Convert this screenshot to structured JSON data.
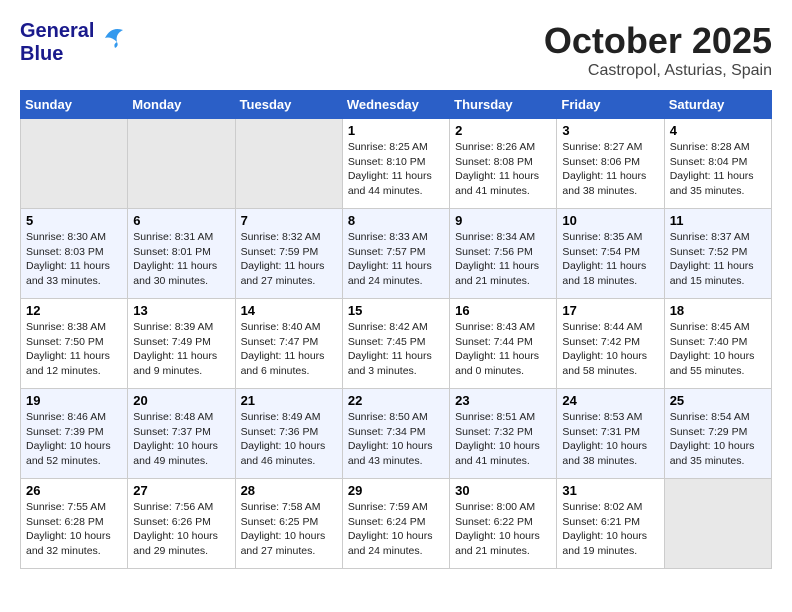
{
  "header": {
    "logo_line1": "General",
    "logo_line2": "Blue",
    "title": "October 2025",
    "subtitle": "Castropol, Asturias, Spain"
  },
  "days_of_week": [
    "Sunday",
    "Monday",
    "Tuesday",
    "Wednesday",
    "Thursday",
    "Friday",
    "Saturday"
  ],
  "weeks": [
    [
      {
        "day": "",
        "sunrise": "",
        "sunset": "",
        "daylight": "",
        "empty": true
      },
      {
        "day": "",
        "sunrise": "",
        "sunset": "",
        "daylight": "",
        "empty": true
      },
      {
        "day": "",
        "sunrise": "",
        "sunset": "",
        "daylight": "",
        "empty": true
      },
      {
        "day": "1",
        "sunrise": "Sunrise: 8:25 AM",
        "sunset": "Sunset: 8:10 PM",
        "daylight": "Daylight: 11 hours and 44 minutes.",
        "empty": false
      },
      {
        "day": "2",
        "sunrise": "Sunrise: 8:26 AM",
        "sunset": "Sunset: 8:08 PM",
        "daylight": "Daylight: 11 hours and 41 minutes.",
        "empty": false
      },
      {
        "day": "3",
        "sunrise": "Sunrise: 8:27 AM",
        "sunset": "Sunset: 8:06 PM",
        "daylight": "Daylight: 11 hours and 38 minutes.",
        "empty": false
      },
      {
        "day": "4",
        "sunrise": "Sunrise: 8:28 AM",
        "sunset": "Sunset: 8:04 PM",
        "daylight": "Daylight: 11 hours and 35 minutes.",
        "empty": false
      }
    ],
    [
      {
        "day": "5",
        "sunrise": "Sunrise: 8:30 AM",
        "sunset": "Sunset: 8:03 PM",
        "daylight": "Daylight: 11 hours and 33 minutes.",
        "empty": false
      },
      {
        "day": "6",
        "sunrise": "Sunrise: 8:31 AM",
        "sunset": "Sunset: 8:01 PM",
        "daylight": "Daylight: 11 hours and 30 minutes.",
        "empty": false
      },
      {
        "day": "7",
        "sunrise": "Sunrise: 8:32 AM",
        "sunset": "Sunset: 7:59 PM",
        "daylight": "Daylight: 11 hours and 27 minutes.",
        "empty": false
      },
      {
        "day": "8",
        "sunrise": "Sunrise: 8:33 AM",
        "sunset": "Sunset: 7:57 PM",
        "daylight": "Daylight: 11 hours and 24 minutes.",
        "empty": false
      },
      {
        "day": "9",
        "sunrise": "Sunrise: 8:34 AM",
        "sunset": "Sunset: 7:56 PM",
        "daylight": "Daylight: 11 hours and 21 minutes.",
        "empty": false
      },
      {
        "day": "10",
        "sunrise": "Sunrise: 8:35 AM",
        "sunset": "Sunset: 7:54 PM",
        "daylight": "Daylight: 11 hours and 18 minutes.",
        "empty": false
      },
      {
        "day": "11",
        "sunrise": "Sunrise: 8:37 AM",
        "sunset": "Sunset: 7:52 PM",
        "daylight": "Daylight: 11 hours and 15 minutes.",
        "empty": false
      }
    ],
    [
      {
        "day": "12",
        "sunrise": "Sunrise: 8:38 AM",
        "sunset": "Sunset: 7:50 PM",
        "daylight": "Daylight: 11 hours and 12 minutes.",
        "empty": false
      },
      {
        "day": "13",
        "sunrise": "Sunrise: 8:39 AM",
        "sunset": "Sunset: 7:49 PM",
        "daylight": "Daylight: 11 hours and 9 minutes.",
        "empty": false
      },
      {
        "day": "14",
        "sunrise": "Sunrise: 8:40 AM",
        "sunset": "Sunset: 7:47 PM",
        "daylight": "Daylight: 11 hours and 6 minutes.",
        "empty": false
      },
      {
        "day": "15",
        "sunrise": "Sunrise: 8:42 AM",
        "sunset": "Sunset: 7:45 PM",
        "daylight": "Daylight: 11 hours and 3 minutes.",
        "empty": false
      },
      {
        "day": "16",
        "sunrise": "Sunrise: 8:43 AM",
        "sunset": "Sunset: 7:44 PM",
        "daylight": "Daylight: 11 hours and 0 minutes.",
        "empty": false
      },
      {
        "day": "17",
        "sunrise": "Sunrise: 8:44 AM",
        "sunset": "Sunset: 7:42 PM",
        "daylight": "Daylight: 10 hours and 58 minutes.",
        "empty": false
      },
      {
        "day": "18",
        "sunrise": "Sunrise: 8:45 AM",
        "sunset": "Sunset: 7:40 PM",
        "daylight": "Daylight: 10 hours and 55 minutes.",
        "empty": false
      }
    ],
    [
      {
        "day": "19",
        "sunrise": "Sunrise: 8:46 AM",
        "sunset": "Sunset: 7:39 PM",
        "daylight": "Daylight: 10 hours and 52 minutes.",
        "empty": false
      },
      {
        "day": "20",
        "sunrise": "Sunrise: 8:48 AM",
        "sunset": "Sunset: 7:37 PM",
        "daylight": "Daylight: 10 hours and 49 minutes.",
        "empty": false
      },
      {
        "day": "21",
        "sunrise": "Sunrise: 8:49 AM",
        "sunset": "Sunset: 7:36 PM",
        "daylight": "Daylight: 10 hours and 46 minutes.",
        "empty": false
      },
      {
        "day": "22",
        "sunrise": "Sunrise: 8:50 AM",
        "sunset": "Sunset: 7:34 PM",
        "daylight": "Daylight: 10 hours and 43 minutes.",
        "empty": false
      },
      {
        "day": "23",
        "sunrise": "Sunrise: 8:51 AM",
        "sunset": "Sunset: 7:32 PM",
        "daylight": "Daylight: 10 hours and 41 minutes.",
        "empty": false
      },
      {
        "day": "24",
        "sunrise": "Sunrise: 8:53 AM",
        "sunset": "Sunset: 7:31 PM",
        "daylight": "Daylight: 10 hours and 38 minutes.",
        "empty": false
      },
      {
        "day": "25",
        "sunrise": "Sunrise: 8:54 AM",
        "sunset": "Sunset: 7:29 PM",
        "daylight": "Daylight: 10 hours and 35 minutes.",
        "empty": false
      }
    ],
    [
      {
        "day": "26",
        "sunrise": "Sunrise: 7:55 AM",
        "sunset": "Sunset: 6:28 PM",
        "daylight": "Daylight: 10 hours and 32 minutes.",
        "empty": false
      },
      {
        "day": "27",
        "sunrise": "Sunrise: 7:56 AM",
        "sunset": "Sunset: 6:26 PM",
        "daylight": "Daylight: 10 hours and 29 minutes.",
        "empty": false
      },
      {
        "day": "28",
        "sunrise": "Sunrise: 7:58 AM",
        "sunset": "Sunset: 6:25 PM",
        "daylight": "Daylight: 10 hours and 27 minutes.",
        "empty": false
      },
      {
        "day": "29",
        "sunrise": "Sunrise: 7:59 AM",
        "sunset": "Sunset: 6:24 PM",
        "daylight": "Daylight: 10 hours and 24 minutes.",
        "empty": false
      },
      {
        "day": "30",
        "sunrise": "Sunrise: 8:00 AM",
        "sunset": "Sunset: 6:22 PM",
        "daylight": "Daylight: 10 hours and 21 minutes.",
        "empty": false
      },
      {
        "day": "31",
        "sunrise": "Sunrise: 8:02 AM",
        "sunset": "Sunset: 6:21 PM",
        "daylight": "Daylight: 10 hours and 19 minutes.",
        "empty": false
      },
      {
        "day": "",
        "sunrise": "",
        "sunset": "",
        "daylight": "",
        "empty": true
      }
    ]
  ]
}
